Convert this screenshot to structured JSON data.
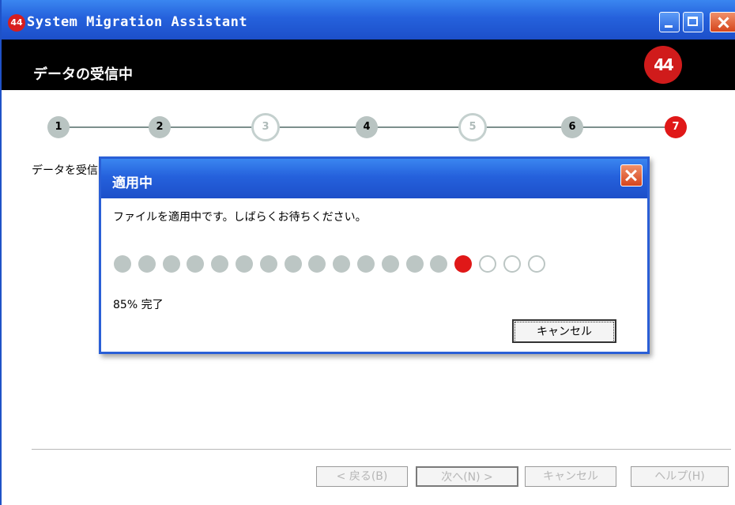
{
  "window": {
    "title": "System Migration Assistant",
    "icon_text": "44",
    "controls": [
      "minimize",
      "maximize",
      "close"
    ]
  },
  "header": {
    "title": "データの受信中",
    "logo_text": "44"
  },
  "steps": [
    {
      "label": "1",
      "state": "done"
    },
    {
      "label": "2",
      "state": "done"
    },
    {
      "label": "3",
      "state": "skipped"
    },
    {
      "label": "4",
      "state": "done"
    },
    {
      "label": "5",
      "state": "skipped"
    },
    {
      "label": "6",
      "state": "done"
    },
    {
      "label": "7",
      "state": "current"
    }
  ],
  "main": {
    "text": "データを受信"
  },
  "footer": {
    "back_label": "< 戻る(B)",
    "next_label": "次へ(N) >",
    "cancel_label": "キャンセル",
    "help_label": "ヘルプ(H)"
  },
  "dialog": {
    "title": "適用中",
    "message": "ファイルを適用中です。しばらくお待ちください。",
    "progress_dots_total": 18,
    "progress_dots_filled": 15,
    "progress_percent_label": "85% 完了",
    "cancel_label": "キャンセル"
  },
  "colors": {
    "titlebar": "#2561dc",
    "accent_red": "#e01818",
    "dot_grey": "#bcc6c4",
    "header_bg": "#000000"
  }
}
